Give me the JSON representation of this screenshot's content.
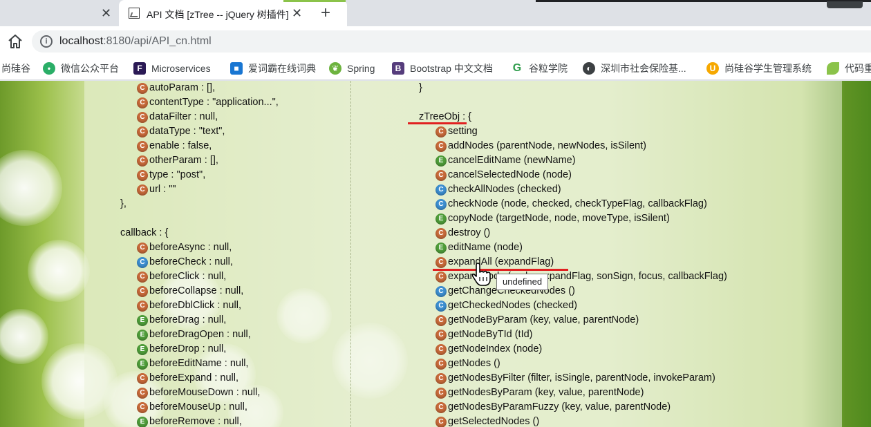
{
  "browser": {
    "tab_active_title": "API 文档 [zTree -- jQuery 树插件]",
    "url_host": "localhost",
    "url_rest": ":8180/api/API_cn.html",
    "accent": "#8bc34a"
  },
  "bookmarks": [
    {
      "label": "尚硅谷",
      "icon": "text-only"
    },
    {
      "label": "微信公众平台",
      "icon": "wechat-icon",
      "color": "#2aae67"
    },
    {
      "label": "Microservices",
      "icon": "f-icon",
      "color": "#2b1a55"
    },
    {
      "label": "爱词霸在线词典",
      "icon": "iciba-icon",
      "color": "#1976d2"
    },
    {
      "label": "Spring",
      "icon": "spring-leaf-icon",
      "color": "#6db33f"
    },
    {
      "label": "Bootstrap 中文文档",
      "icon": "bootstrap-icon",
      "color": "#563d7c"
    },
    {
      "label": "谷粒学院",
      "icon": "g-icon",
      "color": "#2e9c4b"
    },
    {
      "label": "深圳市社会保险基...",
      "icon": "globe-icon",
      "color": "#3c4043"
    },
    {
      "label": "尚硅谷学生管理系统",
      "icon": "u-icon",
      "color": "#f6a800"
    },
    {
      "label": "代码重",
      "icon": "leaf-icon",
      "color": "#8bc34a"
    }
  ],
  "left_column": [
    {
      "badge": "C",
      "color": "orange",
      "text": "autoParam : [],",
      "indent": 2
    },
    {
      "badge": "C",
      "color": "orange",
      "text": "contentType : \"application...\",",
      "indent": 2
    },
    {
      "badge": "C",
      "color": "orange",
      "text": "dataFilter : null,",
      "indent": 2
    },
    {
      "badge": "C",
      "color": "orange",
      "text": "dataType : \"text\",",
      "indent": 2
    },
    {
      "badge": "C",
      "color": "orange",
      "text": "enable : false,",
      "indent": 2
    },
    {
      "badge": "C",
      "color": "orange",
      "text": "otherParam : [],",
      "indent": 2
    },
    {
      "badge": "C",
      "color": "orange",
      "text": "type : \"post\",",
      "indent": 2
    },
    {
      "badge": "C",
      "color": "orange",
      "text": "url : \"\"",
      "indent": 2
    },
    {
      "badge": "",
      "color": "",
      "text": "},",
      "indent": 1
    },
    {
      "badge": "",
      "color": "",
      "text": "",
      "indent": 1
    },
    {
      "badge": "",
      "color": "",
      "text": "callback : {",
      "indent": 1
    },
    {
      "badge": "C",
      "color": "orange",
      "text": "beforeAsync : null,",
      "indent": 2
    },
    {
      "badge": "C",
      "color": "blue",
      "text": "beforeCheck : null,",
      "indent": 2
    },
    {
      "badge": "C",
      "color": "orange",
      "text": "beforeClick : null,",
      "indent": 2
    },
    {
      "badge": "C",
      "color": "orange",
      "text": "beforeCollapse : null,",
      "indent": 2
    },
    {
      "badge": "C",
      "color": "orange",
      "text": "beforeDblClick : null,",
      "indent": 2
    },
    {
      "badge": "E",
      "color": "green",
      "text": "beforeDrag : null,",
      "indent": 2
    },
    {
      "badge": "E",
      "color": "green",
      "text": "beforeDragOpen : null,",
      "indent": 2
    },
    {
      "badge": "E",
      "color": "green",
      "text": "beforeDrop : null,",
      "indent": 2
    },
    {
      "badge": "E",
      "color": "green",
      "text": "beforeEditName : null,",
      "indent": 2
    },
    {
      "badge": "C",
      "color": "orange",
      "text": "beforeExpand : null,",
      "indent": 2
    },
    {
      "badge": "C",
      "color": "orange",
      "text": "beforeMouseDown : null,",
      "indent": 2
    },
    {
      "badge": "C",
      "color": "orange",
      "text": "beforeMouseUp : null,",
      "indent": 2
    },
    {
      "badge": "E",
      "color": "green",
      "text": "beforeRemove : null,",
      "indent": 2
    }
  ],
  "right_column": [
    {
      "badge": "",
      "color": "",
      "text": "}",
      "indent": 1
    },
    {
      "badge": "",
      "color": "",
      "text": "",
      "indent": 1
    },
    {
      "badge": "",
      "color": "",
      "text": "zTreeObj : {",
      "indent": 1
    },
    {
      "badge": "C",
      "color": "orange",
      "text": "setting",
      "indent": 2
    },
    {
      "badge": "C",
      "color": "orange",
      "text": "addNodes (parentNode, newNodes, isSilent)",
      "indent": 2
    },
    {
      "badge": "E",
      "color": "green",
      "text": "cancelEditName (newName)",
      "indent": 2
    },
    {
      "badge": "C",
      "color": "orange",
      "text": "cancelSelectedNode (node)",
      "indent": 2
    },
    {
      "badge": "C",
      "color": "blue",
      "text": "checkAllNodes (checked)",
      "indent": 2
    },
    {
      "badge": "C",
      "color": "blue",
      "text": "checkNode (node, checked, checkTypeFlag, callbackFlag)",
      "indent": 2
    },
    {
      "badge": "E",
      "color": "green",
      "text": "copyNode (targetNode, node, moveType, isSilent)",
      "indent": 2
    },
    {
      "badge": "C",
      "color": "orange",
      "text": "destroy ()",
      "indent": 2
    },
    {
      "badge": "E",
      "color": "green",
      "text": "editName (node)",
      "indent": 2
    },
    {
      "badge": "C",
      "color": "orange",
      "text": "expandAll (expandFlag)",
      "indent": 2
    },
    {
      "badge": "C",
      "color": "orange",
      "text": "expandNode (node, expandFlag, sonSign, focus, callbackFlag)",
      "indent": 2
    },
    {
      "badge": "C",
      "color": "blue",
      "text": "getChangeCheckedNodes ()",
      "indent": 2
    },
    {
      "badge": "C",
      "color": "blue",
      "text": "getCheckedNodes (checked)",
      "indent": 2
    },
    {
      "badge": "C",
      "color": "orange",
      "text": "getNodeByParam (key, value, parentNode)",
      "indent": 2
    },
    {
      "badge": "C",
      "color": "orange",
      "text": "getNodeByTId (tId)",
      "indent": 2
    },
    {
      "badge": "C",
      "color": "orange",
      "text": "getNodeIndex (node)",
      "indent": 2
    },
    {
      "badge": "C",
      "color": "orange",
      "text": "getNodes ()",
      "indent": 2
    },
    {
      "badge": "C",
      "color": "orange",
      "text": "getNodesByFilter (filter, isSingle, parentNode, invokeParam)",
      "indent": 2
    },
    {
      "badge": "C",
      "color": "orange",
      "text": "getNodesByParam (key, value, parentNode)",
      "indent": 2
    },
    {
      "badge": "C",
      "color": "orange",
      "text": "getNodesByParamFuzzy (key, value, parentNode)",
      "indent": 2
    },
    {
      "badge": "C",
      "color": "orange",
      "text": "getSelectedNodes ()",
      "indent": 2
    }
  ],
  "tooltip": "undefined",
  "badge_colors": {
    "orange": "#c86a3a",
    "blue": "#3d8fd1",
    "green": "#4f9e3a"
  },
  "highlight_color": "#e02020"
}
